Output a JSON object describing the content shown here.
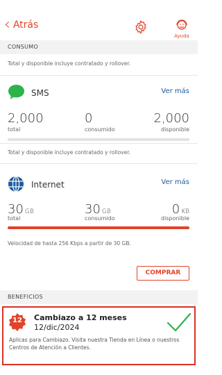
{
  "header": {
    "back_label": "Atrás",
    "help_label": "Ayuda"
  },
  "colors": {
    "accent": "#e0442a",
    "link": "#1f5a9e",
    "sms_green": "#2db34a",
    "internet_blue": "#1f5a9e"
  },
  "consumo": {
    "section_title": "CONSUMO",
    "note": "Total y disponible incluye contratado y rollover."
  },
  "sms": {
    "title": "SMS",
    "icon": "chat-bubble-icon",
    "ver_mas": "Ver más",
    "total_value": "2,000",
    "total_label": "total",
    "consumed_value": "0",
    "consumed_label": "consumido",
    "available_value": "2,000",
    "available_label": "disponible",
    "usage_fraction": 0,
    "note": "Total y disponible incluye contratado y rollover."
  },
  "internet": {
    "title": "Internet",
    "icon": "globe-icon",
    "ver_mas": "Ver más",
    "total_value": "30",
    "total_unit": "GB",
    "total_label": "total",
    "consumed_value": "30",
    "consumed_unit": "GB",
    "consumed_label": "consumido",
    "available_value": "0",
    "available_unit": "KB",
    "available_label": "disponible",
    "usage_fraction": 1,
    "note": "Velocidad de hasta 256 Kbps a partir de 30 GB."
  },
  "comprar_label": "COMPRAR",
  "beneficios": {
    "section_title": "BENEFICIOS",
    "item": {
      "badge": "12",
      "title": "Cambiazo a 12 meses",
      "date": "12/dic/2024",
      "description": "Aplicas para Cambiazo. Visita nuestra Tienda en Línea o nuestros Centros de Atención a Clientes.",
      "status_icon": "checkmark-icon"
    }
  }
}
